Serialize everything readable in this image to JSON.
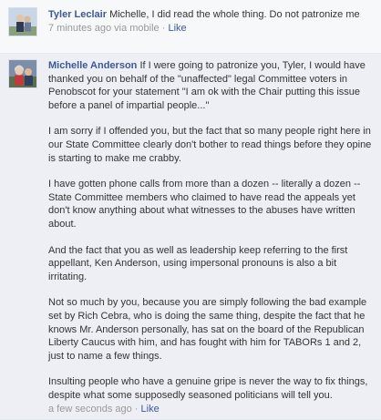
{
  "comments": [
    {
      "author": "Tyler Leclair",
      "text": "Michelle, I did read the whole thing. Do not patronize me",
      "timestamp": "7 minutes ago via mobile",
      "separator": " · ",
      "action": "Like"
    },
    {
      "author": "Michelle Anderson",
      "paragraphs": [
        "If I were going to patronize you, Tyler, I would have thanked you on behalf of the \"unaffected\" legal Committee voters in Penobscot for your statement \"I am ok with the Chair putting this issue before a panel of impartial people...\"",
        "I am sorry if I offended you, but the fact that so many people right here in our State Committee clearly don't bother to read things before they opine is starting to make me crabby.",
        "I have gotten phone calls from more than a dozen -- literally a dozen -- State Committee members who claimed to have read the appeals yet don't know anything about what witnesses to the abuses have written about.",
        "And the fact that you as well as leadership keep referring to the first appellant, Ken Anderson, using impersonal pronouns is also a bit irritating.",
        "Not so much by you, because you are simply following the bad example set by Rich Cebra, who is doing the same thing, despite the fact that he knows Mr. Anderson personally, has sat on the board of the Republican Liberty Caucus with him, and has fought with him for TABORs 1 and 2, just to name a few things.",
        "Insulting people who have a genuine gripe is never the way to fix things, despite what some supposedly seasoned politicians will tell you."
      ],
      "timestamp": "a few seconds ago",
      "separator": " · ",
      "action": "Like"
    }
  ]
}
